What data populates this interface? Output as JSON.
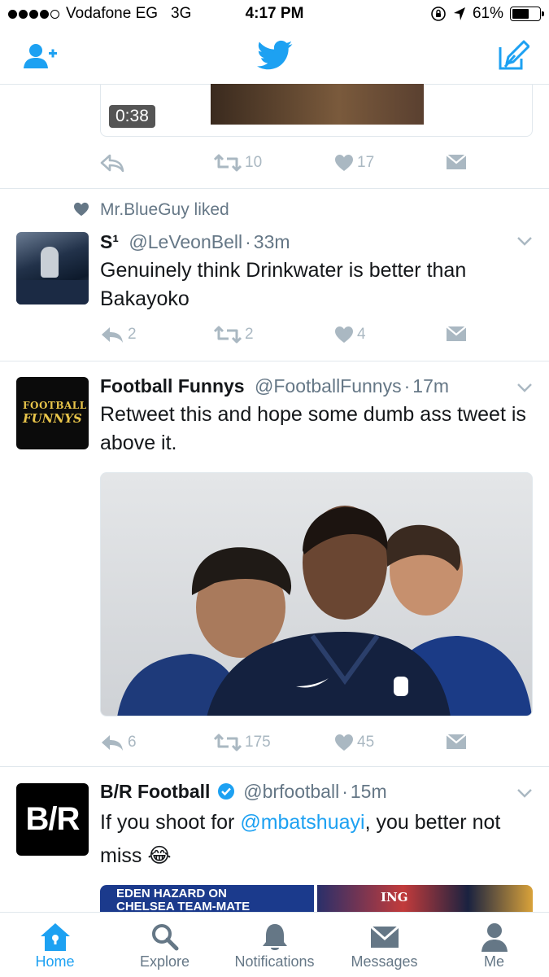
{
  "status_bar": {
    "carrier": "Vodafone EG",
    "network": "3G",
    "time": "4:17 PM",
    "battery": "61%",
    "battery_level": 0.61
  },
  "colors": {
    "accent": "#1da1f2",
    "secondary_text": "#657786",
    "action_gray": "#aab8c2",
    "border": "#e1e8ed"
  },
  "navbar": {
    "left_icon": "add-user-icon",
    "center_icon": "twitter-bird-icon",
    "right_icon": "compose-icon"
  },
  "tweets": [
    {
      "video_duration": "0:38",
      "retweets": "10",
      "likes": "17"
    },
    {
      "context": "Mr.BlueGuy liked",
      "name": "S¹",
      "handle": "@LeVeonBell",
      "sep": "·",
      "time": "33m",
      "text": "Genuinely think Drinkwater is better than Bakayoko",
      "replies": "2",
      "retweets": "2",
      "likes": "4"
    },
    {
      "name": "Football Funnys",
      "handle": "@FootballFunnys",
      "sep": "·",
      "time": "17m",
      "text": "Retweet this and hope some dumb ass tweet is above it.",
      "avatar_text_top": "FOOTBALL",
      "avatar_text_bottom": "FUNNYS",
      "replies": "6",
      "retweets": "175",
      "likes": "45"
    },
    {
      "name": "B/R Football",
      "handle": "@brfootball",
      "sep": "·",
      "time": "15m",
      "text_before": "If you shoot for ",
      "mention": "@mbatshuayi",
      "text_after": ", you better not miss ",
      "emoji": "😂",
      "avatar_text": "B/R",
      "media_caption": "EDEN HAZARD ON CHELSEA TEAM-MATE",
      "media_sponsor": "ING"
    }
  ],
  "tabbar": {
    "tabs": [
      {
        "label": "Home",
        "icon": "home-icon",
        "active": true
      },
      {
        "label": "Explore",
        "icon": "search-icon",
        "active": false
      },
      {
        "label": "Notifications",
        "icon": "bell-icon",
        "active": false
      },
      {
        "label": "Messages",
        "icon": "envelope-icon",
        "active": false
      },
      {
        "label": "Me",
        "icon": "person-icon",
        "active": false
      }
    ]
  }
}
